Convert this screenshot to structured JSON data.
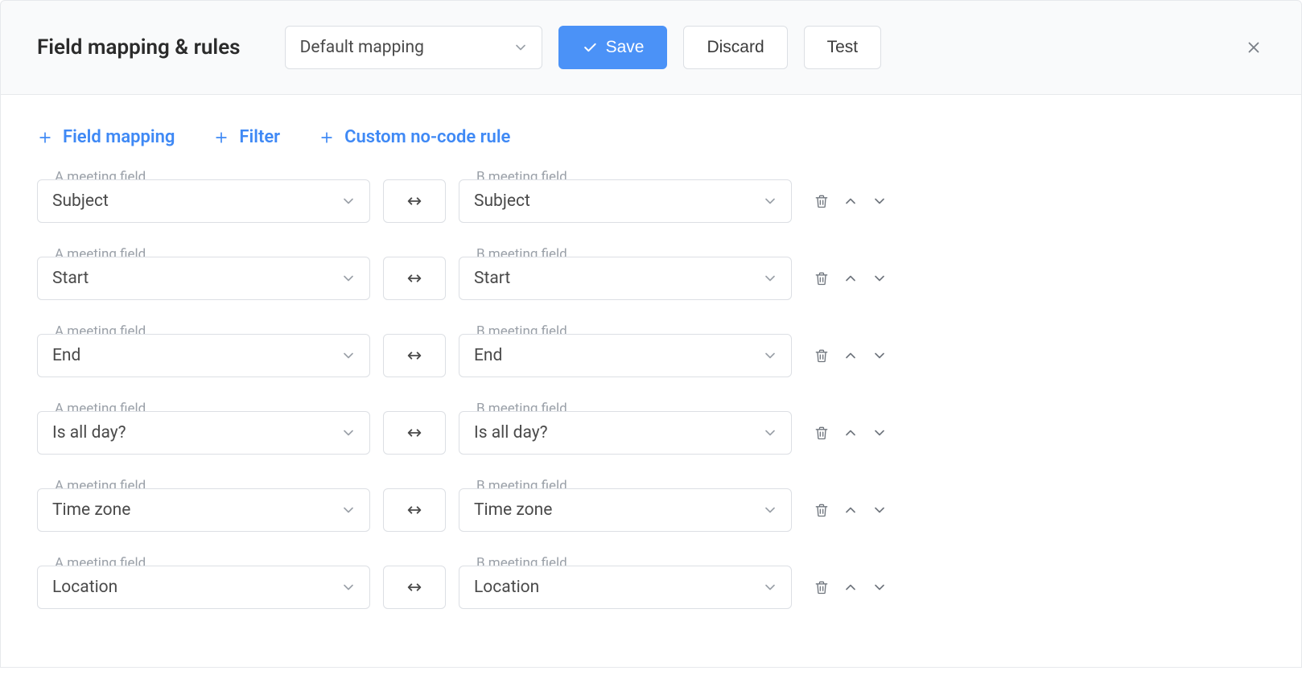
{
  "header": {
    "title": "Field mapping & rules",
    "mapping_select": "Default mapping",
    "save_label": "Save",
    "discard_label": "Discard",
    "test_label": "Test"
  },
  "actions": {
    "field_mapping": "Field mapping",
    "filter": "Filter",
    "custom_rule": "Custom no-code rule"
  },
  "legend": {
    "a": "A meeting field",
    "b": "B meeting field"
  },
  "rows": [
    {
      "a": "Subject",
      "b": "Subject"
    },
    {
      "a": "Start",
      "b": "Start"
    },
    {
      "a": "End",
      "b": "End"
    },
    {
      "a": "Is all day?",
      "b": "Is all day?"
    },
    {
      "a": "Time zone",
      "b": "Time zone"
    },
    {
      "a": "Location",
      "b": "Location"
    }
  ]
}
